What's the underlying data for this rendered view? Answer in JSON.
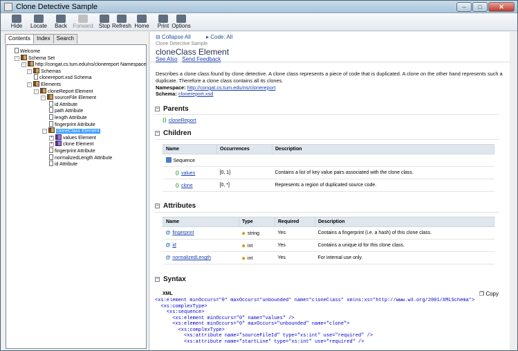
{
  "window": {
    "title": "Clone Detective Sample"
  },
  "toolbar": [
    {
      "label": "Hide",
      "icon": "hide-icon",
      "enabled": true
    },
    {
      "label": "Locate",
      "icon": "locate-icon",
      "enabled": true
    },
    {
      "label": "Back",
      "icon": "back-icon",
      "enabled": true
    },
    {
      "label": "Forward",
      "icon": "forward-icon",
      "enabled": false
    },
    {
      "label": "Stop",
      "icon": "stop-icon",
      "enabled": true
    },
    {
      "label": "Refresh",
      "icon": "refresh-icon",
      "enabled": true
    },
    {
      "label": "Home",
      "icon": "home-icon",
      "enabled": true
    },
    {
      "label": "Print",
      "icon": "print-icon",
      "enabled": true
    },
    {
      "label": "Options",
      "icon": "options-icon",
      "enabled": true
    }
  ],
  "tabs": [
    "Contents",
    "Index",
    "Search"
  ],
  "tree": [
    {
      "label": "Welcome",
      "icon": "page"
    },
    {
      "label": "Schema Set",
      "icon": "book",
      "expand": "-"
    },
    {
      "label": "http://congat.cs.tum.edu/ns/clonereport Namespace",
      "icon": "book",
      "expand": "-"
    },
    {
      "label": "Schemas",
      "icon": "book",
      "expand": "-"
    },
    {
      "label": "clonereport.xsd Schema",
      "icon": "page"
    },
    {
      "label": "Elements",
      "icon": "book",
      "expand": "-"
    },
    {
      "label": "cloneReport Element",
      "icon": "book",
      "expand": "-"
    },
    {
      "label": "sourceFile Element",
      "icon": "book",
      "expand": "-"
    },
    {
      "label": "id Attribute",
      "icon": "page"
    },
    {
      "label": "path Attribute",
      "icon": "page"
    },
    {
      "label": "length Attribute",
      "icon": "page"
    },
    {
      "label": "fingerprint Attribute",
      "icon": "page"
    },
    {
      "label": "cloneClass Element",
      "icon": "book",
      "expand": "-",
      "selected": true
    },
    {
      "label": "values Element",
      "icon": "bookp",
      "expand": "+"
    },
    {
      "label": "clone Element",
      "icon": "bookp",
      "expand": "+"
    },
    {
      "label": "fingerprint Attribute",
      "icon": "page"
    },
    {
      "label": "normalizedLength Attribute",
      "icon": "page"
    },
    {
      "label": "id Attribute",
      "icon": "page"
    }
  ],
  "content": {
    "collapse_all": "Collapse All",
    "code_all": "Code: All",
    "breadcrumb": "Clone Detective Sample",
    "title": "cloneClass Element",
    "see_also": "See Also",
    "send_feedback": "Send Feedback",
    "description": "Describes a clone class found by clone detective. A clone class represents a piece of code that is duplicated. A clone on the other hand represents such a duplicate. Therefore a clone class contains all its clones.",
    "namespace_label": "Namespace:",
    "namespace_value": "http://congat.cs.tum.edu/ns/clonereport",
    "schema_label": "Schema:",
    "schema_value": "clonereport.xsd",
    "parents_title": "Parents",
    "parent_link": "cloneReport",
    "children_title": "Children",
    "children_headers": [
      "Name",
      "Occurrences",
      "Description"
    ],
    "children_sequence": "Sequence",
    "children_rows": [
      {
        "name": "values",
        "occ": "[0, 1]",
        "desc": "Contains a list of key value pairs associated with the clone class."
      },
      {
        "name": "clone",
        "occ": "[0, *]",
        "desc": "Represents a region of duplicated source code."
      }
    ],
    "attributes_title": "Attributes",
    "attr_headers": [
      "Name",
      "Type",
      "Required",
      "Description"
    ],
    "attr_rows": [
      {
        "name": "fingerprint",
        "type": "string",
        "req": "Yes",
        "desc": "Contains a fingerprint (i.e. a hash) of this clone class."
      },
      {
        "name": "id",
        "type": "int",
        "req": "Yes",
        "desc": "Contains a unique id for this clone class."
      },
      {
        "name": "normalizedLength",
        "type": "int",
        "req": "Yes",
        "desc": "For internal use only."
      }
    ],
    "syntax_title": "Syntax",
    "xml_label": "XML",
    "copy_label": "Copy",
    "xml_lines": [
      "<xs:element minOccurs=\"0\" maxOccurs=\"unbounded\" name=\"cloneClass\" xmlns:xs=\"http://www.w3.org/2001/XMLSchema\">",
      "  <xs:complexType>",
      "    <xs:sequence>",
      "      <xs:element minOccurs=\"0\" name=\"values\" />",
      "      <xs:element minOccurs=\"0\" maxOccurs=\"unbounded\" name=\"clone\">",
      "        <xs:complexType>",
      "          <xs:attribute name=\"sourceFileId\" type=\"xs:int\" use=\"required\" />",
      "          <xs:attribute name=\"startLine\" type=\"xs:int\" use=\"required\" />"
    ]
  }
}
